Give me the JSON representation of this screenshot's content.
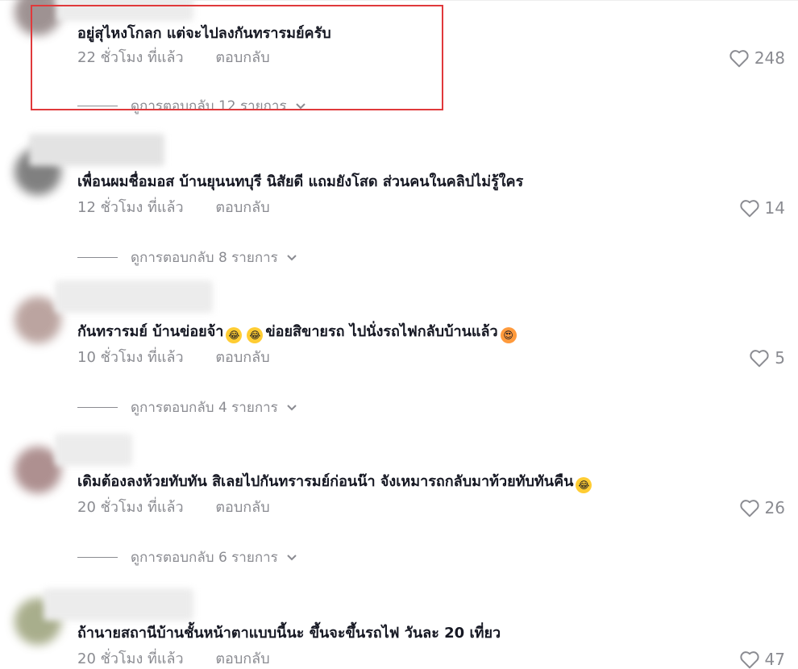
{
  "comments": [
    {
      "text": "อยู่สุไหงโกลก แต่จะไปลงกันทรารมย์ครับ",
      "time": "22 ชั่วโมง ที่แล้ว",
      "reply": "ตอบกลับ",
      "likes": "248",
      "replies": "ดูการตอบกลับ 12 รายการ",
      "avatar_color": "#8e8080",
      "highlighted": true
    },
    {
      "text": "เพื่อนผมชื่อมอส บ้านยุนนทบุรี นิสัยดี แถมยังโสด ส่วนคนในคลิปไม่รู้ใคร",
      "time": "12 ชั่วโมง ที่แล้ว",
      "reply": "ตอบกลับ",
      "likes": "14",
      "replies": "ดูการตอบกลับ 8 รายการ",
      "avatar_color": "#6b6b6b"
    },
    {
      "text_parts": [
        "กันทรารมย์ บ้านข่อยจ้า",
        "ข่อยสิขายรถ ไปนั่งรถไฟกลับบ้านแล้ว"
      ],
      "time": "10 ชั่วโมง ที่แล้ว",
      "reply": "ตอบกลับ",
      "likes": "5",
      "replies": "ดูการตอบกลับ 4 รายการ",
      "avatar_color": "#b09590"
    },
    {
      "text": "เดิมต้องลงห้วยทับทัน สิเลยไปกันทรารมย์ก่อนน๊า จังเหมารถกลับมาท้วยทับทันคืน",
      "time": "20 ชั่วโมง ที่แล้ว",
      "reply": "ตอบกลับ",
      "likes": "26",
      "replies": "ดูการตอบกลับ 6 รายการ",
      "avatar_color": "#a07d7d"
    },
    {
      "text": "ถ้านายสถานีบ้านชั้นหน้าตาแบบนี้นะ ขึ้นจะขึ้นรถไฟ วันละ 20 เที่ยว",
      "time": "20 ชั่วโมง ที่แล้ว",
      "reply": "ตอบกลับ",
      "likes": "47",
      "avatar_color": "#9aa078"
    }
  ],
  "colors": {
    "highlight": "#e0393b",
    "muted": "#8a8b91",
    "text": "#161823"
  },
  "icons": {
    "like": "heart-outline-icon",
    "expand": "chevron-down-icon",
    "emoji_laugh": "rofl-emoji",
    "emoji_love": "heart-eyes-emoji"
  }
}
